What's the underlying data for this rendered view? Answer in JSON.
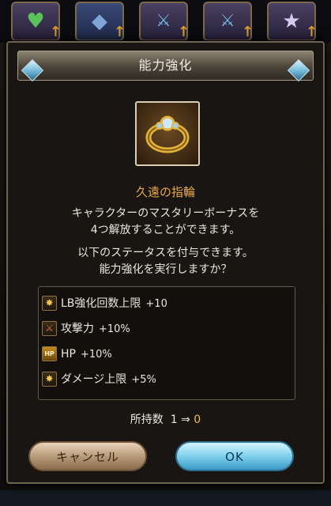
{
  "dialog": {
    "title": "能力強化",
    "item_name": "久遠の指輪",
    "description": [
      "キャラクターのマスタリーボーナスを",
      "4つ解放することができます。"
    ],
    "confirm": [
      "以下のステータスを付与できます。",
      "能力強化を実行しますか？"
    ],
    "stats": [
      {
        "icon": "star-burst-icon",
        "label": "LB強化回数上限",
        "value": "+10"
      },
      {
        "icon": "sword-icon",
        "label": "攻撃力",
        "value": "+10%"
      },
      {
        "icon": "hp-icon",
        "label": "HP",
        "value": "+10%"
      },
      {
        "icon": "star-burst-icon",
        "label": "ダメージ上限",
        "value": "+5%"
      }
    ],
    "owned_label": "所持数",
    "owned_before": "1",
    "owned_arrow": "⇒",
    "owned_after": "0",
    "cancel_label": "キャンセル",
    "ok_label": "OK"
  },
  "icons": {
    "hp_icon_text": "HP",
    "star_glyph": "✸",
    "sword_glyph": "⚔"
  }
}
